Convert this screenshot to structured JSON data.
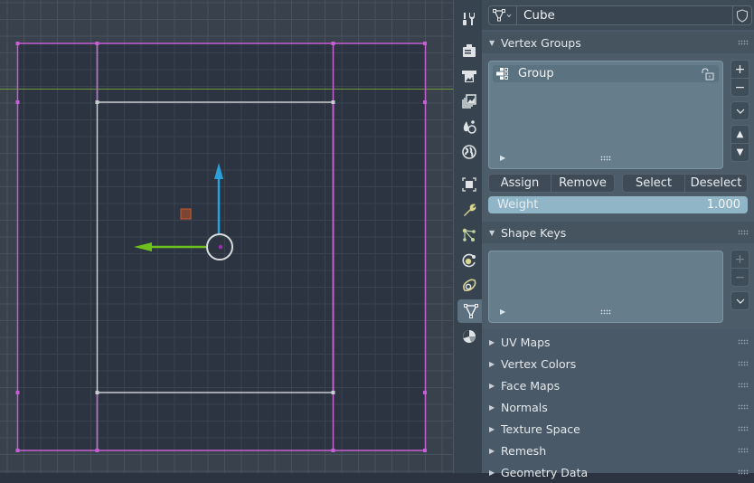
{
  "viewport": {
    "grid_color": "#48525c",
    "bg_color": "#39424c",
    "object_bg_color": "#2b3440",
    "selected_edge_color": "#c55fd2",
    "inner_edge_color": "#c8ccd0",
    "y_axis_line_color": "#6f9a3a",
    "gizmo": {
      "up_arrow_color": "#2a9fd8",
      "left_arrow_color": "#6fbf1d",
      "origin_ring_color": "#d7dbde",
      "origin_dot_color": "#9a30b0"
    },
    "light_marker_color": "#c9582a"
  },
  "tabs": [
    {
      "name": "tool-tab",
      "icon": "tool-icon"
    },
    {
      "name": "render-tab",
      "icon": "render-icon"
    },
    {
      "name": "output-tab",
      "icon": "output-icon"
    },
    {
      "name": "view-layer-tab",
      "icon": "view-layer-icon"
    },
    {
      "name": "scene-tab",
      "icon": "scene-icon"
    },
    {
      "name": "world-tab",
      "icon": "world-icon"
    },
    {
      "name": "object-tab",
      "icon": "object-icon"
    },
    {
      "name": "modifiers-tab",
      "icon": "wrench-icon"
    },
    {
      "name": "particles-tab",
      "icon": "particles-icon"
    },
    {
      "name": "physics-tab",
      "icon": "physics-icon"
    },
    {
      "name": "constraints-tab",
      "icon": "constraints-icon"
    },
    {
      "name": "data-tab",
      "icon": "mesh-data-icon",
      "active": true
    },
    {
      "name": "material-tab",
      "icon": "material-icon"
    }
  ],
  "header": {
    "datablock_name": "Cube"
  },
  "vertex_groups": {
    "title": "Vertex Groups",
    "items": [
      {
        "name": "Group",
        "locked": false
      }
    ],
    "buttons": {
      "assign": "Assign",
      "remove": "Remove",
      "select": "Select",
      "deselect": "Deselect"
    },
    "side_buttons": {
      "add": "+",
      "remove": "−",
      "menu": "⌄",
      "up": "▲",
      "down": "▼"
    },
    "weight": {
      "label": "Weight",
      "value": "1.000"
    }
  },
  "shape_keys": {
    "title": "Shape Keys",
    "side_buttons": {
      "add": "+",
      "remove": "−",
      "menu": "⌄"
    }
  },
  "collapsed_panels": [
    "UV Maps",
    "Vertex Colors",
    "Face Maps",
    "Normals",
    "Texture Space",
    "Remesh",
    "Geometry Data"
  ]
}
